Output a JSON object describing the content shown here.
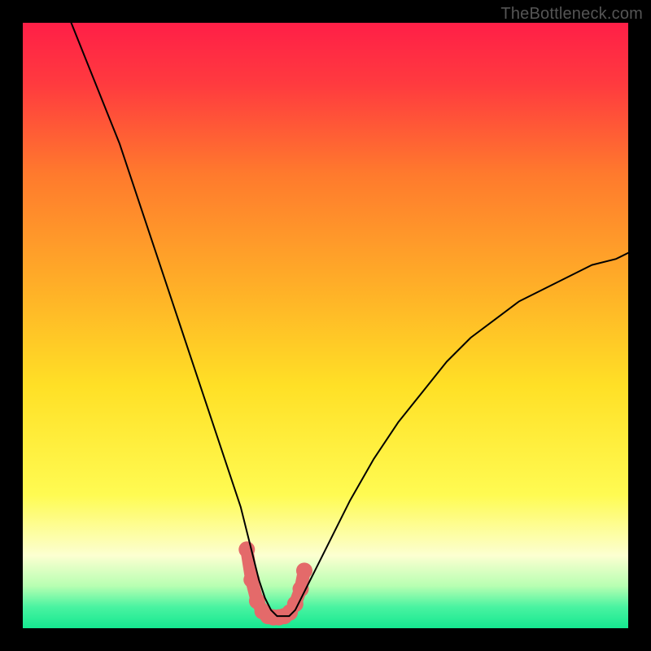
{
  "watermark": "TheBottleneck.com",
  "chart_data": {
    "type": "line",
    "title": "",
    "xlabel": "",
    "ylabel": "",
    "xlim": [
      0,
      100
    ],
    "ylim": [
      0,
      100
    ],
    "grid": false,
    "legend": false,
    "gradient_stops": [
      {
        "offset": 0.0,
        "color": "#ff1f47"
      },
      {
        "offset": 0.1,
        "color": "#ff3a3f"
      },
      {
        "offset": 0.25,
        "color": "#ff7a2d"
      },
      {
        "offset": 0.45,
        "color": "#ffb327"
      },
      {
        "offset": 0.6,
        "color": "#ffe026"
      },
      {
        "offset": 0.78,
        "color": "#fffb52"
      },
      {
        "offset": 0.88,
        "color": "#fcffd1"
      },
      {
        "offset": 0.93,
        "color": "#b8ffb2"
      },
      {
        "offset": 0.965,
        "color": "#49f3a1"
      },
      {
        "offset": 1.0,
        "color": "#15e890"
      }
    ],
    "series": [
      {
        "name": "bottleneck-curve",
        "color": "#000000",
        "width": 2,
        "x": [
          8,
          10,
          12,
          14,
          16,
          18,
          20,
          22,
          24,
          26,
          28,
          30,
          32,
          34,
          36,
          37,
          38,
          39,
          40,
          41,
          42,
          43,
          44,
          45,
          46,
          48,
          50,
          54,
          58,
          62,
          66,
          70,
          74,
          78,
          82,
          86,
          90,
          94,
          98,
          100
        ],
        "y": [
          100,
          95,
          90,
          85,
          80,
          74,
          68,
          62,
          56,
          50,
          44,
          38,
          32,
          26,
          20,
          16,
          12,
          8,
          5,
          3,
          2,
          2,
          2,
          3,
          5,
          9,
          13,
          21,
          28,
          34,
          39,
          44,
          48,
          51,
          54,
          56,
          58,
          60,
          61,
          62
        ]
      }
    ],
    "highlight": {
      "name": "valley-highlight",
      "color": "#e46a6a",
      "marker_radius": 10,
      "x": [
        37.0,
        37.8,
        38.7,
        39.6,
        40.5,
        41.4,
        42.3,
        43.2,
        44.1,
        45.0,
        45.9,
        46.5
      ],
      "y": [
        13.0,
        8.0,
        4.5,
        2.8,
        2.0,
        1.8,
        1.8,
        2.0,
        2.6,
        4.0,
        6.5,
        9.5
      ]
    }
  }
}
